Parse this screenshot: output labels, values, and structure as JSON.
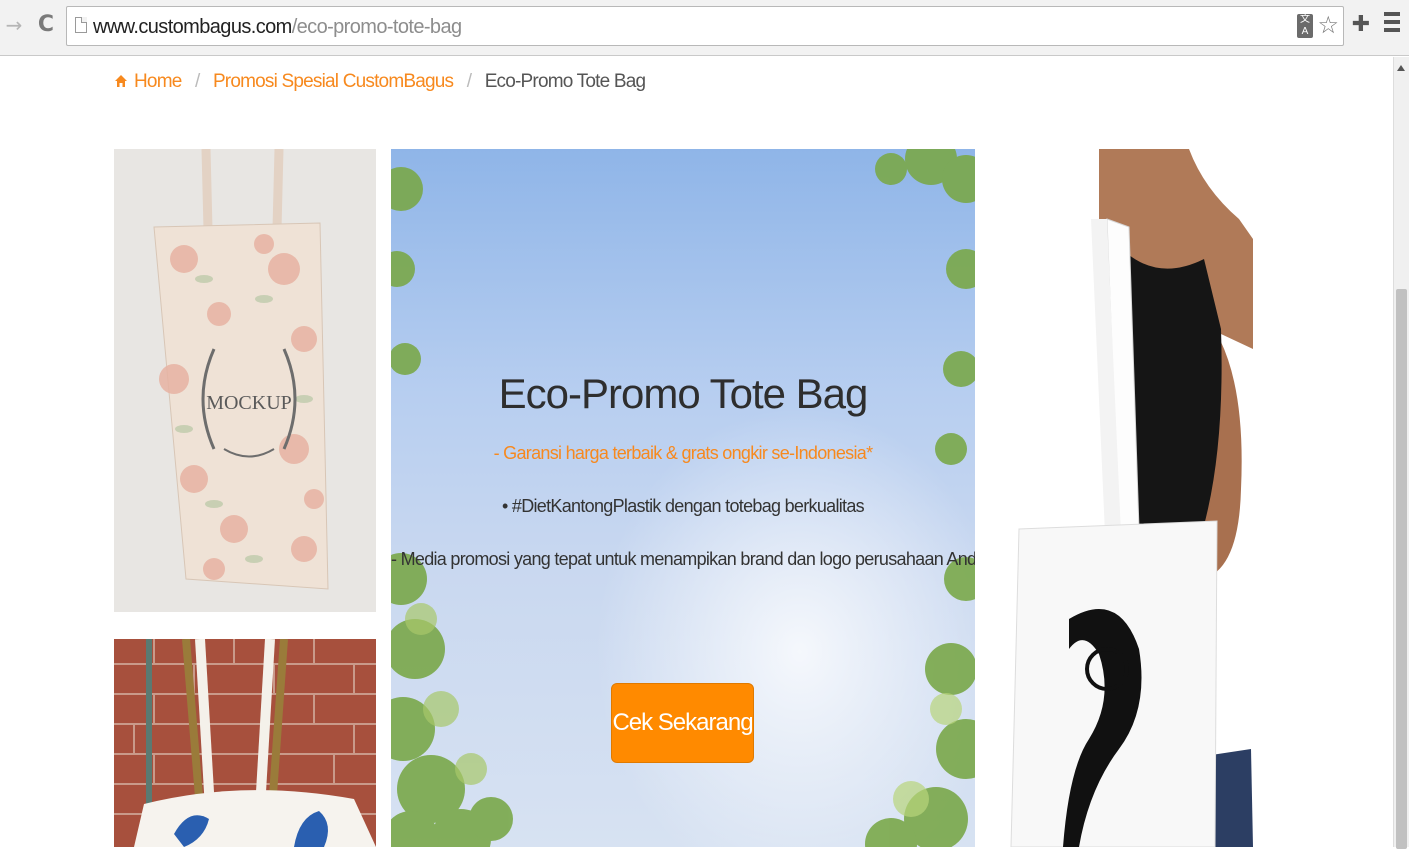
{
  "browser": {
    "url_host": "www.custombagus.com",
    "url_path": "/eco-promo-tote-bag",
    "icons": {
      "forward": "forward-arrow-icon",
      "reload": "reload-icon",
      "page": "page-icon",
      "translate": "translate-icon",
      "bookmark": "star-icon",
      "extensions": "puzzle-icon",
      "menu": "menu-icon"
    }
  },
  "breadcrumb": {
    "items": [
      {
        "label": "Home",
        "icon": "home-icon",
        "link": true
      },
      {
        "label": "Promosi Spesial CustomBagus",
        "link": true
      },
      {
        "label": "Eco-Promo Tote Bag",
        "link": false
      }
    ],
    "separator": "/"
  },
  "hero": {
    "title": "Eco-Promo Tote Bag",
    "lines": [
      "- Garansi harga terbaik & grats ongkir se-Indonesia*",
      "• #DietKantongPlastik dengan totebag berkualitas",
      "- Media promosi yang tepat untuk menampikan brand dan logo perusahaan Anda"
    ],
    "cta_label": "Cek Sekarang"
  },
  "images": {
    "left_top": {
      "mockup_text": "MOCKUP"
    }
  },
  "colors": {
    "accent": "#f7891e",
    "cta": "#ff8a00",
    "text": "#333333"
  }
}
